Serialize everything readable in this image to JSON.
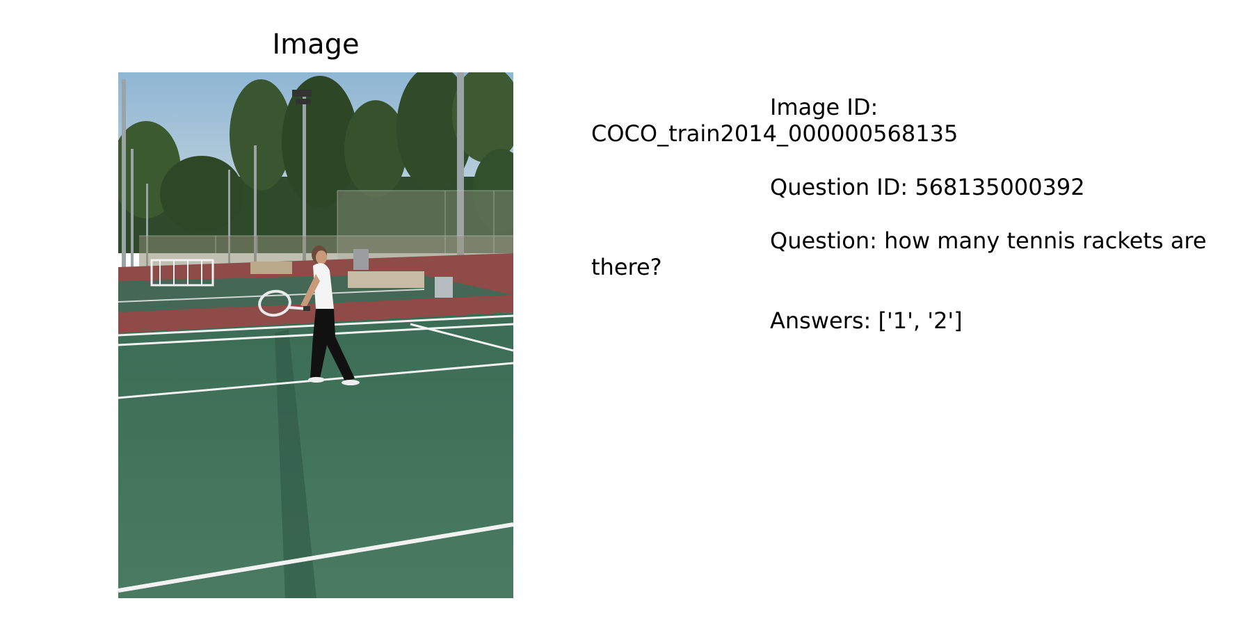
{
  "panel": {
    "title": "Image"
  },
  "info": {
    "image_id_line": "Image ID: COCO_train2014_000000568135",
    "question_id_line": "Question ID: 568135000392",
    "question_line": "Question: how many tennis rackets are there?",
    "answers_line": "Answers: ['1', '2']"
  },
  "photo": {
    "subject": "tennis player on outdoor court",
    "colors": {
      "sky": "#9fc0d6",
      "trees": "#2f4a2a",
      "court": "#3f6f57",
      "court_border": "#8e4b47",
      "lines": "#f2f2f2",
      "shirt": "#f4f4f4",
      "pants": "#111111"
    }
  }
}
